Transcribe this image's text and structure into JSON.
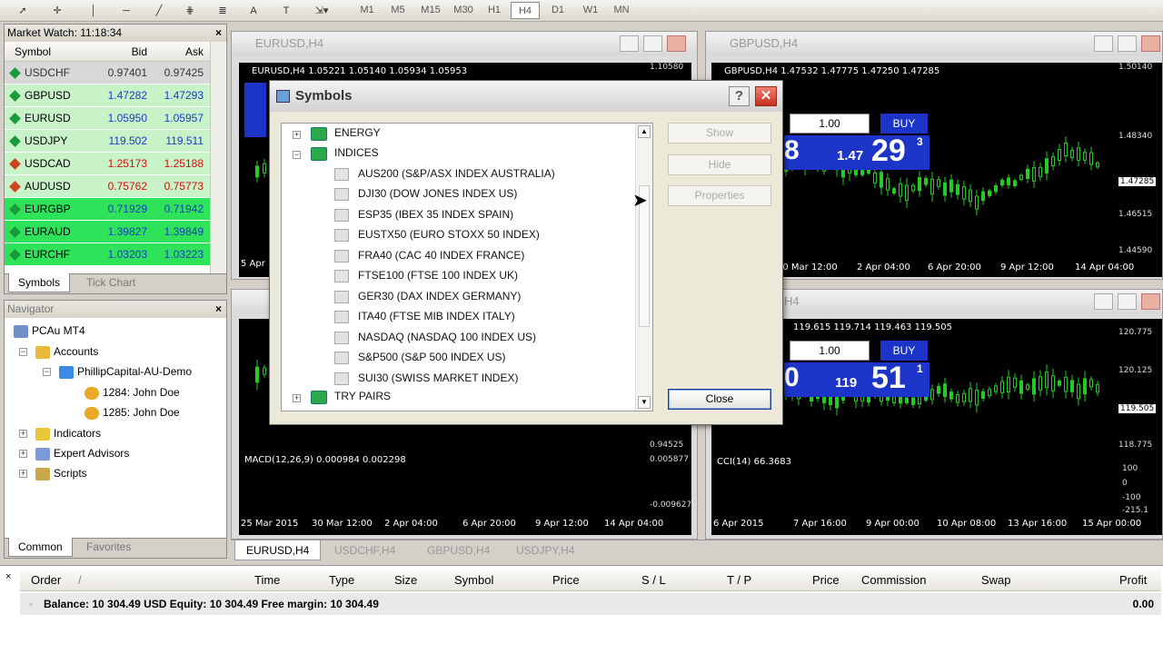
{
  "toolbar": {
    "timeframes": [
      "M1",
      "M5",
      "M15",
      "M30",
      "H1",
      "H4",
      "D1",
      "W1",
      "MN"
    ],
    "active_timeframe": "H4"
  },
  "market_watch": {
    "title": "Market Watch: 11:18:34",
    "columns": [
      "Symbol",
      "Bid",
      "Ask"
    ],
    "rows": [
      {
        "symbol": "USDCHF",
        "bid": "0.97401",
        "ask": "0.97425"
      },
      {
        "symbol": "GBPUSD",
        "bid": "1.47282",
        "ask": "1.47293"
      },
      {
        "symbol": "EURUSD",
        "bid": "1.05950",
        "ask": "1.05957"
      },
      {
        "symbol": "USDJPY",
        "bid": "119.502",
        "ask": "119.511"
      },
      {
        "symbol": "USDCAD",
        "bid": "1.25173",
        "ask": "1.25188"
      },
      {
        "symbol": "AUDUSD",
        "bid": "0.75762",
        "ask": "0.75773"
      },
      {
        "symbol": "EURGBP",
        "bid": "0.71929",
        "ask": "0.71942"
      },
      {
        "symbol": "EURAUD",
        "bid": "1.39827",
        "ask": "1.39849"
      },
      {
        "symbol": "EURCHF",
        "bid": "1.03203",
        "ask": "1.03223"
      }
    ],
    "tabs": [
      "Symbols",
      "Tick Chart"
    ]
  },
  "navigator": {
    "title": "Navigator",
    "root": "PCAu MT4",
    "accounts": "Accounts",
    "server": "PhillipCapital-AU-Demo",
    "acct1": "1284: John Doe",
    "acct2": "1285: John Doe",
    "indicators": "Indicators",
    "experts": "Expert Advisors",
    "scripts": "Scripts",
    "tabs": [
      "Common",
      "Favorites"
    ]
  },
  "charts": {
    "eurusd": {
      "title": "EURUSD,H4",
      "info": "EURUSD,H4  1.05221 1.05140 1.05934 1.05953",
      "price_top": "1.10580",
      "price_mid": "0.94525",
      "macd_label": "MACD(12,26,9) 0.000984 0.002298",
      "macd_top": "0.005877",
      "macd_bot": "-0.009627",
      "dates": [
        "25 Mar 2015",
        "30 Mar 12:00",
        "2 Apr 04:00",
        "6 Apr 20:00",
        "9 Apr 12:00",
        "14 Apr 04:00"
      ],
      "peek_date": "5 Apr"
    },
    "gbpusd": {
      "title": "GBPUSD,H4",
      "info": "GBPUSD,H4  1.47532 1.47775 1.47250 1.47285",
      "lot": "1.00",
      "buy": "BUY",
      "price_small": "1.47",
      "price_big": "29",
      "price_sup": "3",
      "price_left": "8",
      "prices": [
        "1.50140",
        "1.48340",
        "1.47285",
        "1.46515",
        "1.44590"
      ],
      "dates": [
        "30 Mar 12:00",
        "2 Apr 04:00",
        "6 Apr 20:00",
        "9 Apr 12:00",
        "14 Apr 04:00"
      ]
    },
    "usdjpy": {
      "title": "H4",
      "info": "119.615 119.714 119.463 119.505",
      "lot": "1.00",
      "buy": "BUY",
      "price_small": "119",
      "price_big": "51",
      "price_sup": "1",
      "price_left": "0",
      "prices": [
        "120.775",
        "120.125",
        "119.505",
        "118.775"
      ],
      "cci_label": "CCI(14) 66.3683",
      "cci_vals": [
        "100",
        "0",
        "-100",
        "-215.1"
      ],
      "dates": [
        "6 Apr 2015",
        "7 Apr 16:00",
        "9 Apr 00:00",
        "10 Apr 08:00",
        "13 Apr 16:00",
        "15 Apr 00:00"
      ]
    }
  },
  "chart_tabs": [
    "EURUSD,H4",
    "USDCHF,H4",
    "GBPUSD,H4",
    "USDJPY,H4"
  ],
  "dialog": {
    "title": "Symbols",
    "help": "?",
    "groups": [
      {
        "label": "ENERGY"
      },
      {
        "label": "INDICES"
      },
      {
        "label": "TRY PAIRS"
      }
    ],
    "items": [
      "AUS200  (S&P/ASX INDEX AUSTRALIA)",
      "DJI30  (DOW JONES INDEX US)",
      "ESP35  (IBEX 35 INDEX SPAIN)",
      "EUSTX50  (EURO STOXX 50 INDEX)",
      "FRA40  (CAC 40 INDEX FRANCE)",
      "FTSE100  (FTSE 100 INDEX UK)",
      "GER30  (DAX INDEX GERMANY)",
      "ITA40  (FTSE MIB INDEX ITALY)",
      "NASDAQ  (NASDAQ 100 INDEX US)",
      "S&P500  (S&P 500 INDEX US)",
      "SUI30  (SWISS MARKET INDEX)"
    ],
    "buttons": {
      "show": "Show",
      "hide": "Hide",
      "properties": "Properties",
      "close": "Close"
    }
  },
  "terminal": {
    "columns": [
      "Order",
      "/",
      "Time",
      "Type",
      "Size",
      "Symbol",
      "Price",
      "S / L",
      "T / P",
      "Price",
      "Commission",
      "Swap",
      "Profit"
    ],
    "balance": "Balance: 10 304.49 USD  Equity: 10 304.49  Free margin: 10 304.49",
    "profit": "0.00"
  },
  "colors": {
    "up": "#1a3ec0",
    "down": "#d01010",
    "chart_bg": "#000000",
    "candles": "#22cc22",
    "panel": "#1c35c8",
    "dialog_bg": "#ece9d8"
  }
}
